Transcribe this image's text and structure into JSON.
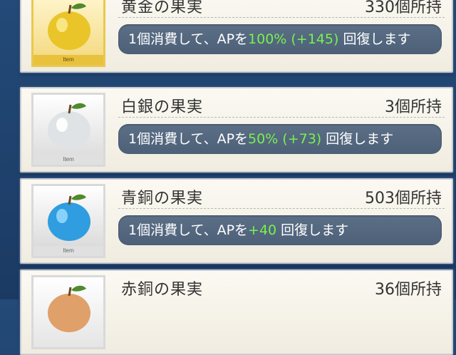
{
  "items": [
    {
      "name": "黄金の果実",
      "count": "330個所持",
      "effect_prefix": "1個消費して、APを",
      "effect_highlight": "100% (+145)",
      "effect_suffix": " 回復します",
      "item_tag": "Item",
      "apple_color": "#e9c52a",
      "icon": "golden-apple-icon"
    },
    {
      "name": "白銀の果実",
      "count": "3個所持",
      "effect_prefix": "1個消費して、APを",
      "effect_highlight": "50% (+73)",
      "effect_suffix": " 回復します",
      "item_tag": "Item",
      "apple_color": "#dfe3e6",
      "icon": "silver-apple-icon"
    },
    {
      "name": "青銅の果実",
      "count": "503個所持",
      "effect_prefix": "1個消費して、APを",
      "effect_highlight": "+40",
      "effect_suffix": " 回復します",
      "item_tag": "Item",
      "apple_color": "#2f9de0",
      "icon": "bronze-apple-icon"
    },
    {
      "name": "赤銅の果実",
      "count": "36個所持",
      "apple_color": "#e0a06a",
      "icon": "copper-apple-icon"
    }
  ],
  "colors": {
    "highlight": "#78f24c",
    "background": "#1d3f6a",
    "effect_bar": "#52657d"
  }
}
